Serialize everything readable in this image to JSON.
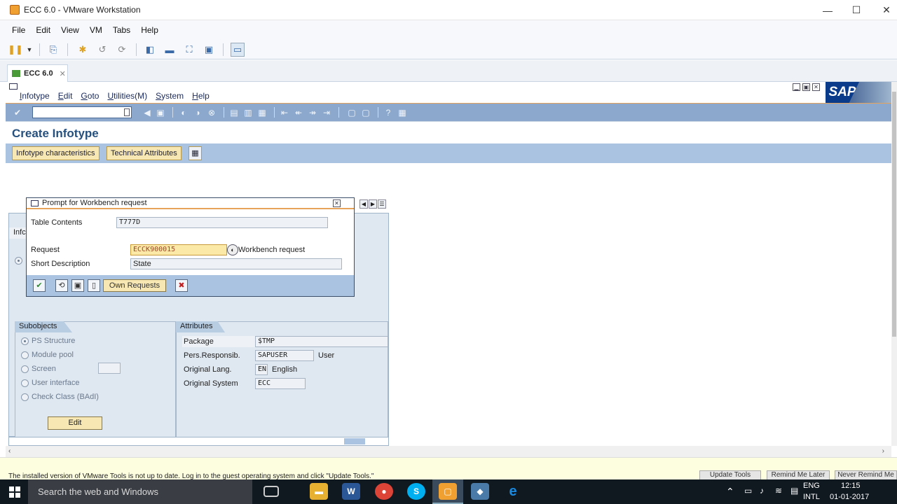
{
  "window": {
    "title": "ECC 6.0 - VMware Workstation",
    "minimize": "—",
    "maximize": "☐",
    "close": "✕"
  },
  "vm_menu": [
    "File",
    "Edit",
    "View",
    "VM",
    "Tabs",
    "Help"
  ],
  "tab": {
    "label": "ECC 6.0",
    "close": "✕"
  },
  "sap": {
    "menu": [
      "Infotype",
      "Edit",
      "Goto",
      "Utilities(M)",
      "System",
      "Help"
    ],
    "logo_text": "SAP",
    "title": "Create Infotype",
    "app_buttons": {
      "characteristics": "Infotype characteristics",
      "technical": "Technical Attributes"
    },
    "subobjects": {
      "header": "Subobjects",
      "options": [
        "PS Structure",
        "Module pool",
        "Screen",
        "User interface",
        "Check Class (BAdI)"
      ],
      "selected": "PS Structure",
      "edit_label": "Edit"
    },
    "attributes": {
      "header": "Attributes",
      "package_label": "Package",
      "package_value": "$TMP",
      "person_label": "Pers.Responsib.",
      "person_value": "SAPUSER",
      "person_suffix": "User",
      "lang_label": "Original Lang.",
      "lang_value": "EN",
      "lang_suffix": "English",
      "system_label": "Original System",
      "system_value": "ECC"
    },
    "partial_label": "Infc"
  },
  "dialog": {
    "title": "Prompt for Workbench request",
    "table_label": "Table Contents",
    "table_value": "T777D",
    "request_label": "Request",
    "request_value": "ECCK900015",
    "request_suffix": "Workbench request",
    "desc_label": "Short Description",
    "desc_value": "State",
    "own_requests": "Own Requests"
  },
  "notice": {
    "message": "The installed version of VMware Tools is not up to date. Log in to the guest operating system and click \"Update Tools.\"",
    "update": "Update Tools",
    "remind": "Remind Me Later",
    "never": "Never Remind Me"
  },
  "taskbar": {
    "search_placeholder": "Search the web and Windows",
    "lang": "ENG",
    "lang_sub": "INTL",
    "time": "12:15",
    "date": "01-01-2017"
  },
  "colors": {
    "sap_toolbar": "#8ca9cd",
    "sap_appbar": "#a9c3e0",
    "sap_title": "#26507e",
    "request_field": "#fbe9a8"
  }
}
